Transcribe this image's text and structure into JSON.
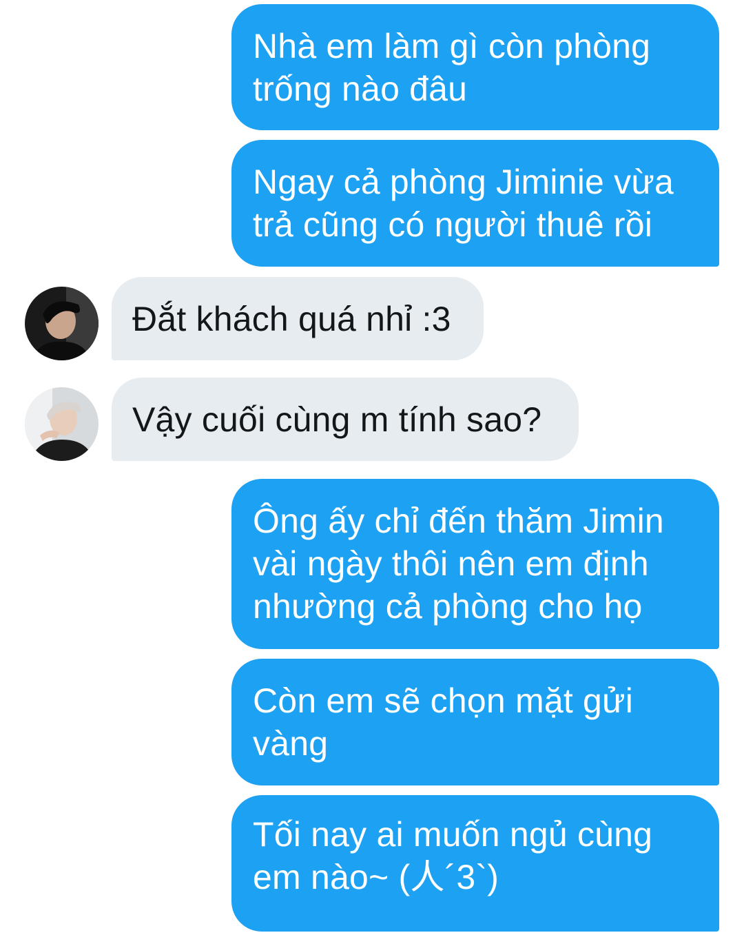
{
  "conversation": {
    "messages": [
      {
        "direction": "outgoing",
        "text": "Nhà em làm gì còn phòng\ntrống nào đâu"
      },
      {
        "direction": "outgoing",
        "text": "Ngay cả phòng Jiminie vừa\ntrả cũng có người thuê rồi"
      },
      {
        "direction": "incoming",
        "avatar": "avatar-icon",
        "text": "Đắt khách quá nhỉ :3"
      },
      {
        "direction": "incoming",
        "avatar": "avatar-icon",
        "text": "Vậy cuối cùng m tính sao?"
      },
      {
        "direction": "outgoing",
        "text": "Ông ấy chỉ đến thăm Jimin\nvài ngày thôi nên em định\nnhường cả phòng cho họ"
      },
      {
        "direction": "outgoing",
        "text": "Còn em sẽ chọn mặt gửi\nvàng"
      },
      {
        "direction": "outgoing",
        "text": "Tối nay ai muốn ngủ cùng\nem nào~ (人´3`)"
      }
    ]
  },
  "colors": {
    "outgoing_bubble": "#1da1f2",
    "incoming_bubble": "#e6ecf0",
    "outgoing_text": "#ffffff",
    "incoming_text": "#14171a"
  }
}
